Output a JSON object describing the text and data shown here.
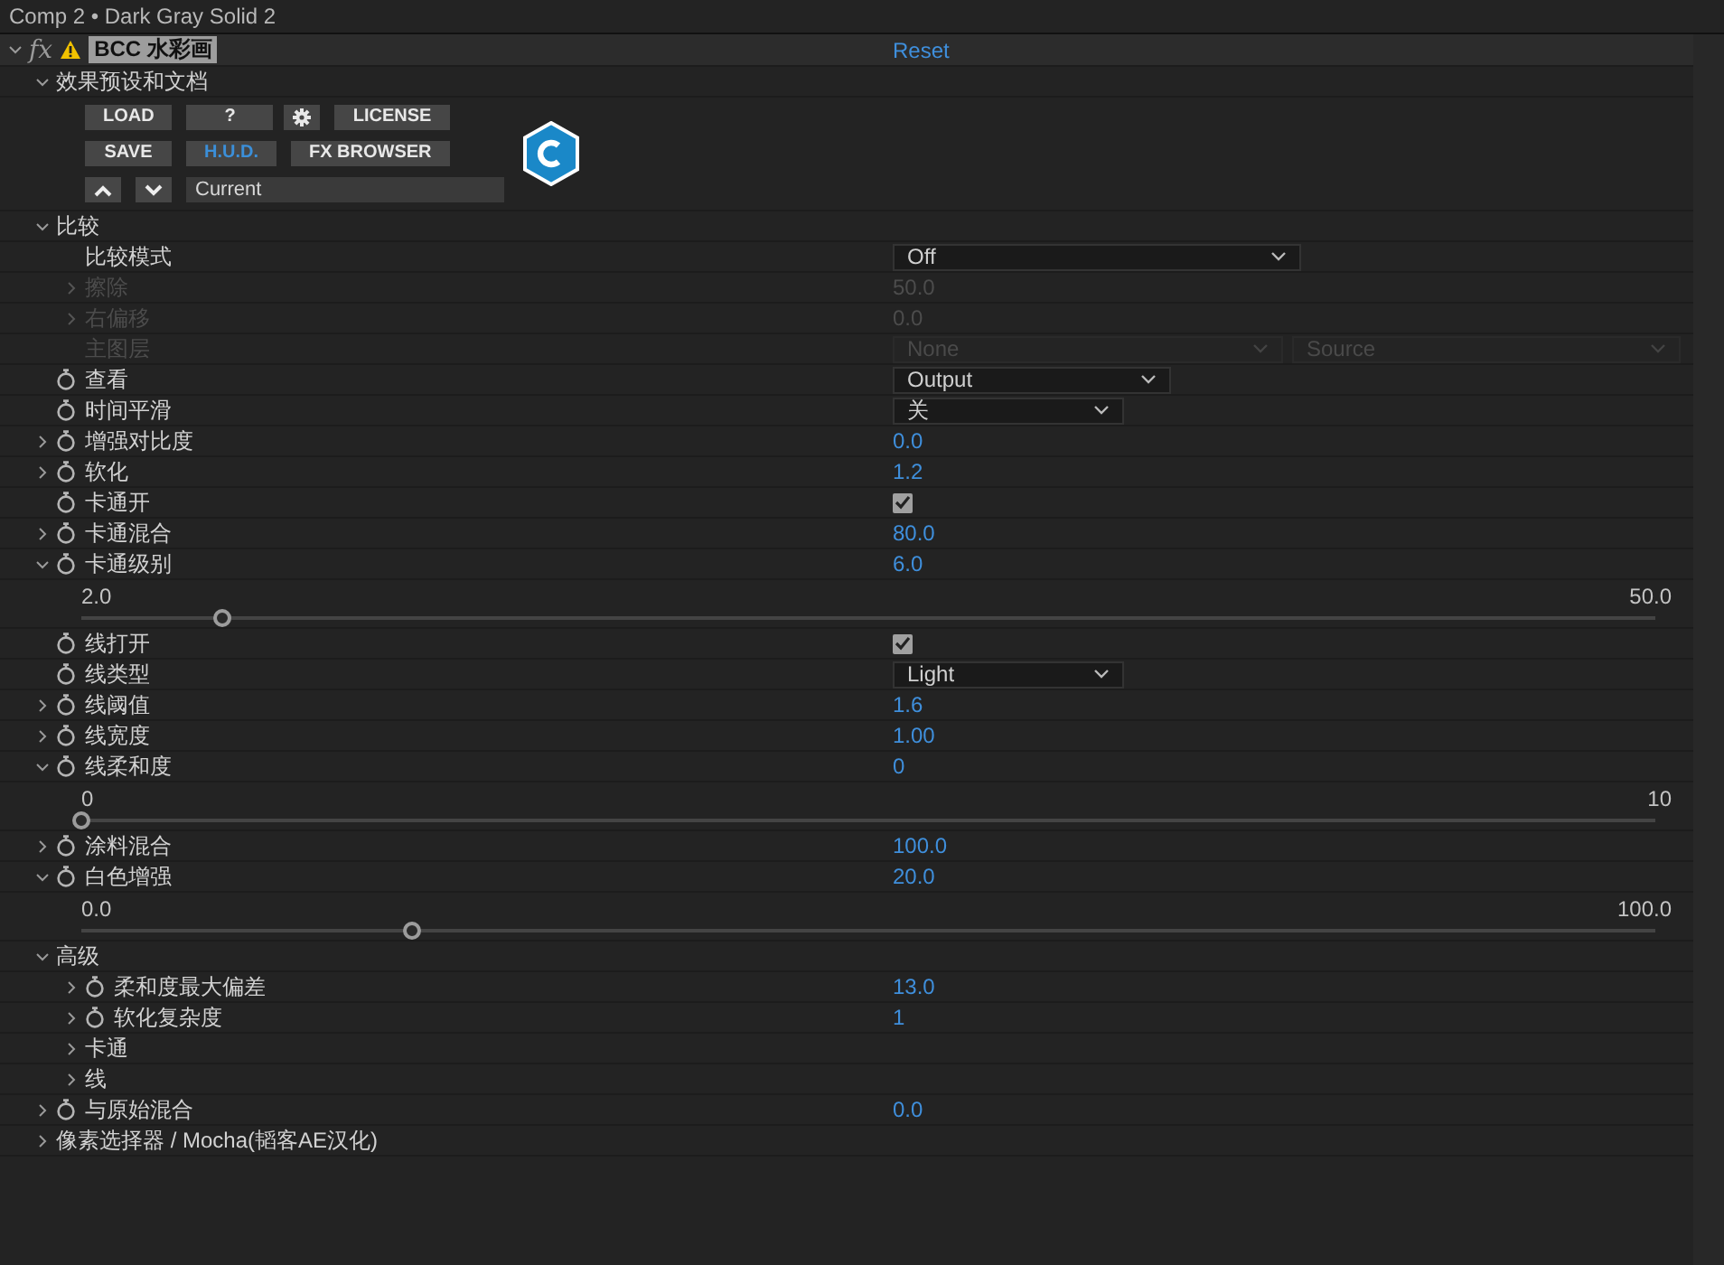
{
  "panel_title": "Comp 2 • Dark Gray Solid 2",
  "effect": {
    "fx": "fx",
    "name": "BCC 水彩画",
    "expanded": true,
    "warning": true,
    "reset": "Reset"
  },
  "presets": {
    "label": "效果预设和文档",
    "expanded": true,
    "row_1": [
      {
        "kind": "text",
        "label": "LOAD",
        "selected": false
      },
      {
        "kind": "text",
        "label": "?",
        "selected": false
      },
      {
        "kind": "gear",
        "selected": false
      },
      {
        "kind": "text",
        "label": "LICENSE",
        "selected": false
      }
    ],
    "row_2": [
      {
        "kind": "text",
        "label": "SAVE",
        "selected": false
      },
      {
        "kind": "text",
        "label": "H.U.D.",
        "selected": true
      },
      {
        "kind": "text",
        "label": "FX BROWSER",
        "selected": false
      }
    ],
    "row_3": [
      {
        "kind": "up"
      },
      {
        "kind": "down"
      }
    ],
    "preset_field": "Current"
  },
  "params": [
    {
      "kind": "group",
      "label": "比较",
      "expanded": true,
      "children": [
        {
          "kind": "dropdown",
          "label": "比较模式",
          "value": "Off",
          "disabled": false,
          "stopwatch": false
        },
        {
          "kind": "number",
          "label": "擦除",
          "value": "50.0",
          "disabled": true,
          "stopwatch": false,
          "expanded": false
        },
        {
          "kind": "number",
          "label": "右偏移",
          "value": "0.0",
          "disabled": true,
          "stopwatch": false,
          "expanded": false
        },
        {
          "kind": "dual_dropdown",
          "label": "主图层",
          "values": [
            "None",
            "Source"
          ],
          "disabled": true,
          "stopwatch": false
        }
      ]
    },
    {
      "kind": "dropdown",
      "label": "查看",
      "value": "Output",
      "disabled": false,
      "stopwatch": true
    },
    {
      "kind": "dropdown",
      "label": "时间平滑",
      "value": "关",
      "disabled": false,
      "stopwatch": true
    },
    {
      "kind": "number",
      "label": "增强对比度",
      "value": "0.0",
      "disabled": false,
      "stopwatch": true,
      "expanded": false
    },
    {
      "kind": "number",
      "label": "软化",
      "value": "1.2",
      "disabled": false,
      "stopwatch": true,
      "expanded": false
    },
    {
      "kind": "checkbox",
      "label": "卡通开",
      "checked": true,
      "disabled": false,
      "stopwatch": true
    },
    {
      "kind": "number",
      "label": "卡通混合",
      "value": "80.0",
      "disabled": false,
      "stopwatch": true,
      "expanded": false
    },
    {
      "kind": "slider",
      "label": "卡通级别",
      "value": "6.0",
      "min": "2.0",
      "max": "50.0",
      "level": 0.09,
      "disabled": false,
      "stopwatch": true,
      "expanded": true
    },
    {
      "kind": "checkbox",
      "label": "线打开",
      "checked": true,
      "disabled": false,
      "stopwatch": true
    },
    {
      "kind": "dropdown",
      "label": "线类型",
      "value": "Light",
      "disabled": false,
      "stopwatch": true
    },
    {
      "kind": "number",
      "label": "线阈值",
      "value": "1.6",
      "disabled": false,
      "stopwatch": true,
      "expanded": false
    },
    {
      "kind": "number",
      "label": "线宽度",
      "value": "1.00",
      "disabled": false,
      "stopwatch": true,
      "expanded": false
    },
    {
      "kind": "slider",
      "label": "线柔和度",
      "value": "0",
      "min": "0",
      "max": "10",
      "level": 0,
      "disabled": false,
      "stopwatch": true,
      "expanded": true
    },
    {
      "kind": "number",
      "label": "涂料混合",
      "value": "100.0",
      "disabled": false,
      "stopwatch": true,
      "expanded": false
    },
    {
      "kind": "slider",
      "label": "白色增强",
      "value": "20.0",
      "min": "0.0",
      "max": "100.0",
      "level": 0.21,
      "disabled": false,
      "stopwatch": true,
      "expanded": true
    },
    {
      "kind": "group",
      "label": "高级",
      "expanded": true,
      "children": [
        {
          "kind": "number",
          "label": "柔和度最大偏差",
          "value": "13.0",
          "disabled": false,
          "stopwatch": true,
          "expanded": false
        },
        {
          "kind": "number",
          "label": "软化复杂度",
          "value": "1",
          "disabled": false,
          "stopwatch": true,
          "expanded": false
        },
        {
          "kind": "group",
          "label": "卡通",
          "expanded": false
        },
        {
          "kind": "group",
          "label": "线",
          "expanded": false
        }
      ]
    },
    {
      "kind": "number",
      "label": "与原始混合",
      "value": "0.0",
      "disabled": false,
      "stopwatch": true,
      "expanded": false
    },
    {
      "kind": "group",
      "label": "像素选择器 / Mocha(韬客AE汉化)",
      "expanded": false
    }
  ]
}
